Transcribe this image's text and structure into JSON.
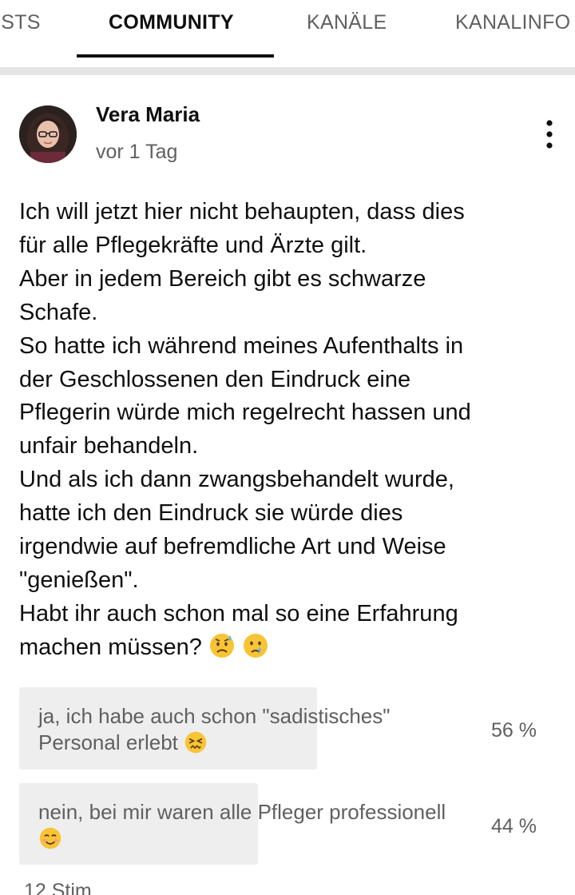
{
  "tabs": [
    {
      "label": "ISTS"
    },
    {
      "label": "COMMUNITY"
    },
    {
      "label": "KANÄLE"
    },
    {
      "label": "KANALINFO"
    }
  ],
  "active_tab": "COMMUNITY",
  "post": {
    "author": "Vera Maria",
    "time": "vor 1 Tag",
    "text": "Ich will jetzt hier nicht behaupten, dass dies\nfür alle Pflegekräfte und Ärzte gilt.\nAber in jedem Bereich gibt es schwarze\nSchafe.\nSo hatte ich während meines Aufenthalts in\nder Geschlossenen den Eindruck eine\nPflegerin würde mich regelrecht hassen und\nunfair behandeln.\nUnd als ich dann zwangsbehandelt wurde,\nhatte ich den Eindruck sie würde dies\nirgendwie auf befremdliche Art und Weise\n\"genießen\".\nHabt ihr auch schon mal so eine Erfahrung\nmachen müssen?",
    "text_trailing_emojis": [
      "sad-sweat-emoji",
      "crying-emoji"
    ]
  },
  "poll": {
    "options": [
      {
        "text": "ja, ich habe auch schon \"sadistisches\" Personal erlebt",
        "emoji": "confounded-emoji",
        "percent": "56 %",
        "share": 0.56
      },
      {
        "text": "nein, bei mir waren alle Pfleger professionell",
        "emoji": "smiling-emoji",
        "percent": "44 %",
        "share": 0.44
      }
    ]
  },
  "footer_partial": "12 Stim",
  "colors": {
    "primary_text": "#0f0f0f",
    "secondary_text": "#606060",
    "divider": "#e5e5e5",
    "poll_bar": "#eeeeee"
  }
}
